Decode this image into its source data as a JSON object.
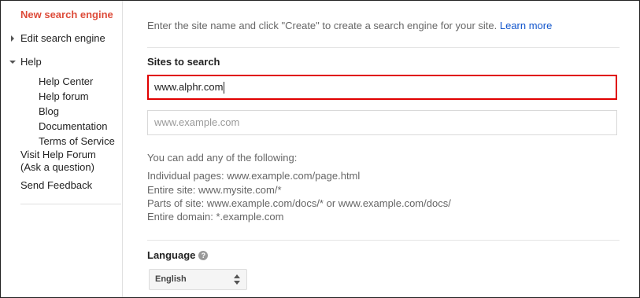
{
  "sidebar": {
    "new_search_engine": "New search engine",
    "edit_search_engine": "Edit search engine",
    "help": "Help",
    "help_items": [
      "Help Center",
      "Help forum",
      "Blog",
      "Documentation",
      "Terms of Service"
    ],
    "visit_help_forum_line1": "Visit Help Forum",
    "visit_help_forum_line2": "(Ask a question)",
    "send_feedback": "Send Feedback"
  },
  "main": {
    "intro_text": "Enter the site name and click \"Create\" to create a search engine for your site.",
    "learn_more": "Learn more",
    "sites_title": "Sites to search",
    "site_input_value": "www.alphr.com",
    "site_input_placeholder": "www.example.com",
    "hint_heading": "You can add any of the following:",
    "hints": [
      {
        "label": "Individual pages:",
        "value": "www.example.com/page.html"
      },
      {
        "label": "Entire site:",
        "value": "www.mysite.com/*"
      },
      {
        "label": "Parts of site:",
        "value": "www.example.com/docs/* or www.example.com/docs/"
      },
      {
        "label": "Entire domain:",
        "value": "*.example.com"
      }
    ],
    "language_title": "Language",
    "language_help_icon": "?",
    "language_selected": "English"
  },
  "colors": {
    "accent_red": "#dd4b39",
    "active_border": "#e00000",
    "link_blue": "#1155cc"
  },
  "icons": {
    "edit_expander": "triangle-right-icon",
    "help_expander": "triangle-down-icon",
    "language_help": "question-circle-icon",
    "select_arrows": "up-down-arrows-icon"
  }
}
